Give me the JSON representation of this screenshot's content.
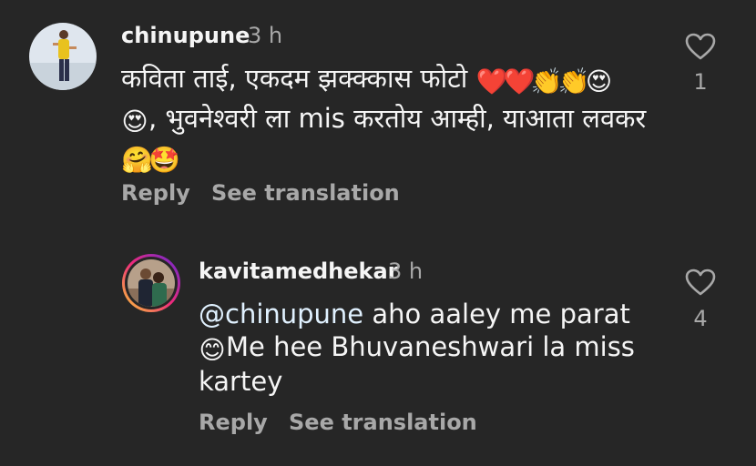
{
  "comments": [
    {
      "username": "chinupune",
      "time": "3 h",
      "text_line1": "कविता ताई, एकदम झक्क्कास फोटो",
      "line1_emojis": [
        "❤️",
        "❤️",
        "👏",
        "👏",
        "😍"
      ],
      "line2_lead_emoji": "😍",
      "text_line2": ", भुवनेश्वरी ला mis करतोय आम्ही, याआता लवकर",
      "line3_emojis": [
        "🤗",
        "🤩"
      ],
      "reply_label": "Reply",
      "translate_label": "See translation",
      "likes": "1"
    },
    {
      "username": "kavitamedhekar",
      "time": "3 h",
      "mention": "@chinupune",
      "text_line1": " aho aaley me parat",
      "line2_lead_emoji": "😊",
      "text_line2": "Me hee Bhuvaneshwari la miss",
      "text_line3": "kartey",
      "reply_label": "Reply",
      "translate_label": "See translation",
      "likes": "4"
    }
  ],
  "icons": {
    "heart": "heart-outline-icon"
  },
  "colors": {
    "background": "#262626",
    "primary_text": "#f5f5f5",
    "secondary_text": "#a8a8a8",
    "story_ring_start": "#f9ce34",
    "story_ring_mid": "#ee2a7b",
    "story_ring_end": "#6228d7"
  }
}
